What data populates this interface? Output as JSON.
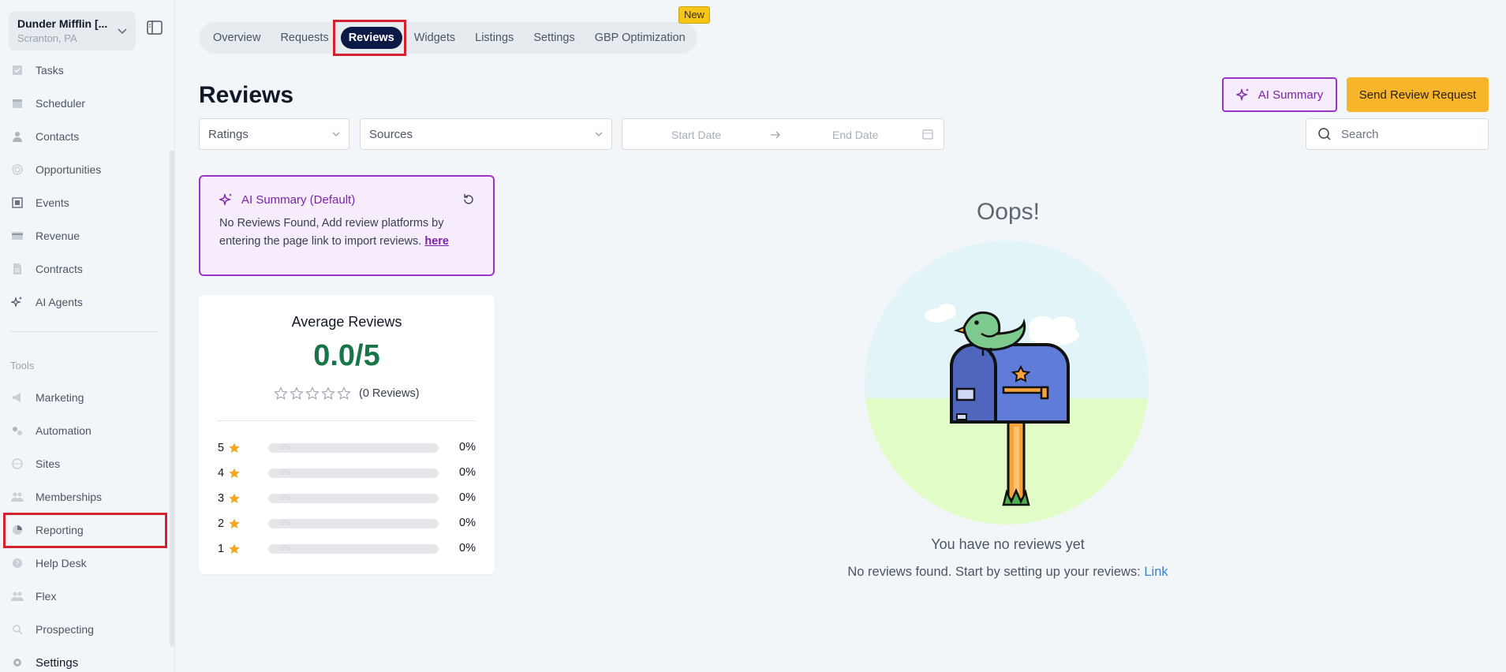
{
  "account": {
    "name": "Dunder Mifflin [...",
    "location": "Scranton, PA"
  },
  "sidebar": {
    "items": [
      {
        "label": "Tasks",
        "icon": "task-icon"
      },
      {
        "label": "Scheduler",
        "icon": "calendar-icon"
      },
      {
        "label": "Contacts",
        "icon": "person-icon"
      },
      {
        "label": "Opportunities",
        "icon": "target-icon"
      },
      {
        "label": "Events",
        "icon": "event-icon"
      },
      {
        "label": "Revenue",
        "icon": "card-icon"
      },
      {
        "label": "Contracts",
        "icon": "document-icon"
      },
      {
        "label": "AI Agents",
        "icon": "sparkle-icon"
      }
    ],
    "tools_title": "Tools",
    "tools": [
      {
        "label": "Marketing",
        "icon": "megaphone-icon"
      },
      {
        "label": "Automation",
        "icon": "gears-icon"
      },
      {
        "label": "Sites",
        "icon": "globe-icon"
      },
      {
        "label": "Memberships",
        "icon": "people-icon"
      },
      {
        "label": "Reporting",
        "icon": "pie-chart-icon"
      },
      {
        "label": "Help Desk",
        "icon": "help-icon"
      },
      {
        "label": "Flex",
        "icon": "people-icon"
      },
      {
        "label": "Prospecting",
        "icon": "magnifier-icon"
      }
    ],
    "settings": {
      "label": "Settings",
      "icon": "gear-icon"
    }
  },
  "tabs": [
    "Overview",
    "Requests",
    "Reviews",
    "Widgets",
    "Listings",
    "Settings",
    "GBP Optimization"
  ],
  "active_tab": "Reviews",
  "new_badge": "New",
  "page": {
    "title": "Reviews"
  },
  "actions": {
    "ai_summary": "AI Summary",
    "send_request": "Send Review Request"
  },
  "filters": {
    "ratings": "Ratings",
    "sources": "Sources",
    "start_date": "Start Date",
    "end_date": "End Date",
    "search_placeholder": "Search"
  },
  "ai_card": {
    "title": "AI Summary (Default)",
    "text": "No Reviews Found, Add review platforms by entering the page link to import reviews.",
    "link": "here"
  },
  "average": {
    "title": "Average Reviews",
    "value": "0.0/5",
    "count_text": "(0 Reviews)",
    "rows": [
      {
        "stars": "5",
        "bar_label": "0%",
        "pct": "0%",
        "fill": 0
      },
      {
        "stars": "4",
        "bar_label": "0%",
        "pct": "0%",
        "fill": 0
      },
      {
        "stars": "3",
        "bar_label": "0%",
        "pct": "0%",
        "fill": 0
      },
      {
        "stars": "2",
        "bar_label": "0%",
        "pct": "0%",
        "fill": 0
      },
      {
        "stars": "1",
        "bar_label": "0%",
        "pct": "0%",
        "fill": 0
      }
    ]
  },
  "empty": {
    "heading": "Oops!",
    "title": "You have no reviews yet",
    "text": "No reviews found. Start by setting up your reviews:",
    "link": "Link"
  },
  "colors": {
    "accent_purple": "#9b35c9",
    "button_yellow": "#f7b52c",
    "nav_active": "#0b1a45",
    "rating_green": "#16764a",
    "highlight_red": "#d6222e"
  }
}
